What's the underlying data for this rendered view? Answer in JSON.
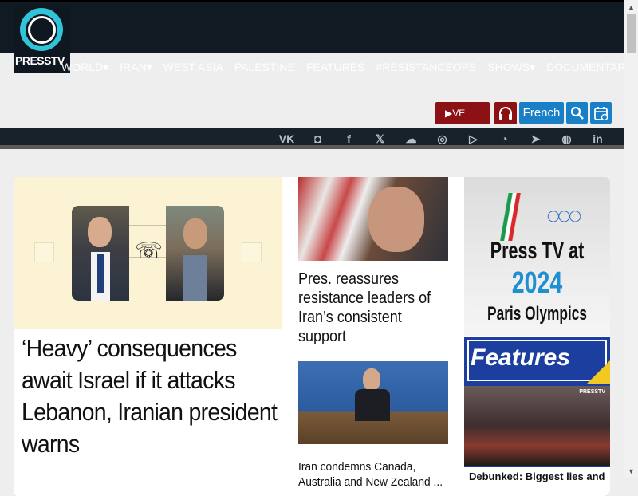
{
  "brand": {
    "logo_text": "PRESSTV"
  },
  "nav": {
    "items": [
      {
        "label": "WORLD",
        "has_dropdown": true
      },
      {
        "label": "IRAN",
        "has_dropdown": true
      },
      {
        "label": "WEST ASIA",
        "has_dropdown": false
      },
      {
        "label": "PALESTINE",
        "has_dropdown": false
      },
      {
        "label": "FEATURES",
        "has_dropdown": false
      },
      {
        "label": "#RESISTANCEOPS",
        "has_dropdown": false
      },
      {
        "label": "SHOWS",
        "has_dropdown": true
      },
      {
        "label": "DOCUMENTARIES",
        "has_dropdown": false
      }
    ],
    "dropdown_glyph": "▾"
  },
  "actions": {
    "live_label": "▶VE",
    "headphone_icon": "headphones-icon",
    "language_label": "French",
    "search_icon": "search-icon",
    "calendar_icon": "calendar-icon"
  },
  "social": [
    {
      "name": "vk-icon",
      "glyph": "VK"
    },
    {
      "name": "castbox-icon",
      "glyph": "◘"
    },
    {
      "name": "facebook-icon",
      "glyph": "f"
    },
    {
      "name": "x-icon",
      "glyph": "𝕏"
    },
    {
      "name": "soundcloud-icon",
      "glyph": "☁"
    },
    {
      "name": "instagram-icon",
      "glyph": "◎"
    },
    {
      "name": "rumble-icon",
      "glyph": "▷"
    },
    {
      "name": "rss-icon",
      "glyph": "◔"
    },
    {
      "name": "telegram-icon",
      "glyph": "➤"
    },
    {
      "name": "globe-icon",
      "glyph": "◍"
    },
    {
      "name": "linkedin-icon",
      "glyph": "in"
    }
  ],
  "hero": {
    "title": "‘Heavy’ consequences await Israel if it attacks Lebanon, Iranian president warns",
    "phone_icon": "☏"
  },
  "stories": [
    {
      "title": "Pres. reassures resistance leaders of Iran’s consistent support"
    },
    {
      "title": "Iran condemns Canada, Australia and New Zealand ..."
    }
  ],
  "promo_olympics": {
    "line1": "Press TV at",
    "line2": "2024",
    "line3": "Paris Olympics",
    "rings": "◯◯◯"
  },
  "promo_features": {
    "label": "Features",
    "watermark": "PRESSTV",
    "caption": "Debunked: Biggest lies and"
  },
  "scrollbar": {
    "up": "▲",
    "down": "▼"
  },
  "colors": {
    "topbar": "#111a22",
    "live": "#8b1114",
    "accent": "#1980c8",
    "features": "#1b3e9f"
  }
}
